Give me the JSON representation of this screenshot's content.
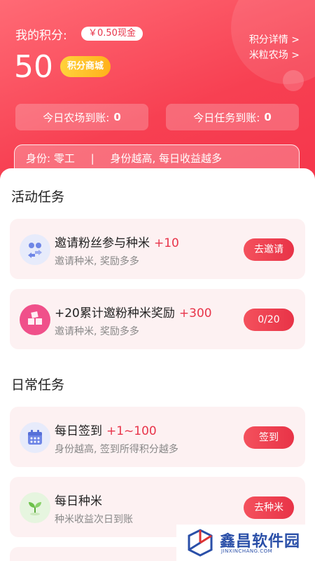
{
  "header": {
    "points_label": "我的积分:",
    "cash_badge": "￥0.50现金",
    "points_value": "50",
    "mall_button": "积分商城",
    "link_points_detail": "积分详情 >",
    "link_rice_farm": "米粒农场 >",
    "stat_farm_label": "今日农场到账:",
    "stat_farm_value": "0",
    "stat_task_label": "今日任务到账:",
    "stat_task_value": "0",
    "identity_text": "身份: 零工",
    "identity_sep": "|",
    "identity_hint": "身份越高, 每日收益越多"
  },
  "sections": {
    "activity_title": "活动任务",
    "daily_title": "日常任务"
  },
  "tasks": [
    {
      "title": "邀请粉丝参与种米",
      "bonus": "+10",
      "desc": "邀请种米, 奖励多多",
      "button": "去邀请",
      "icon": "invite-users-icon"
    },
    {
      "title": "+20累计邀粉种米奖励",
      "bonus": "+300",
      "desc": "邀请种米, 奖励多多",
      "button": "0/20",
      "icon": "gift-box-icon"
    },
    {
      "title": "每日签到",
      "bonus": "+1~100",
      "desc": "身份越高, 签到所得积分越多",
      "button": "签到",
      "icon": "calendar-icon"
    },
    {
      "title": "每日种米",
      "bonus": "",
      "desc": "种米收益次日到账",
      "button": "去种米",
      "icon": "sprout-icon"
    }
  ],
  "watermark": {
    "text": "鑫昌软件园",
    "sub": "JINXINCHANG.COM"
  },
  "colors": {
    "accent": "#e8344a",
    "header_gradient_start": "#ff6a75",
    "header_gradient_end": "#f5344a",
    "mall_gold": "#ffc02a"
  }
}
